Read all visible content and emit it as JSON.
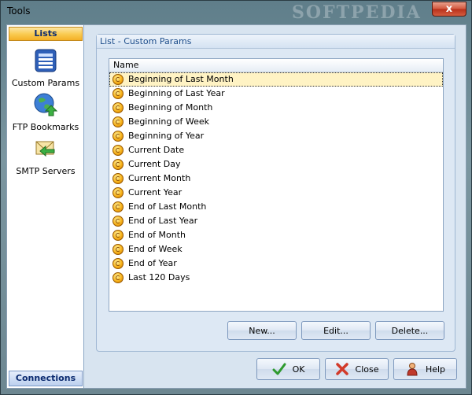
{
  "window": {
    "title": "Tools",
    "watermark": "SOFTPEDIA",
    "close_glyph": "x"
  },
  "nav": {
    "header": "Lists",
    "items": [
      {
        "label": "Custom Params",
        "icon": "custom-params-icon"
      },
      {
        "label": "FTP Bookmarks",
        "icon": "ftp-globe-icon"
      },
      {
        "label": "SMTP Servers",
        "icon": "smtp-envelope-icon"
      }
    ],
    "footer": "Connections"
  },
  "main": {
    "group_title": "List - Custom Params",
    "column_header": "Name",
    "rows": [
      "Beginning of Last Month",
      "Beginning of Last Year",
      "Beginning of Month",
      "Beginning of Week",
      "Beginning of Year",
      "Current Date",
      "Current Day",
      "Current Month",
      "Current Year",
      "End of Last Month",
      "End of Last Year",
      "End of Month",
      "End of Week",
      "End of Year",
      "Last 120 Days"
    ],
    "selected_row": 0,
    "buttons": {
      "new": "New...",
      "edit": "Edit...",
      "delete": "Delete..."
    }
  },
  "footer": {
    "ok": "OK",
    "close": "Close",
    "help": "Help"
  },
  "colors": {
    "accent": "#f9c94e",
    "title_text": "#1f4f8c",
    "selection": "#fff3c4"
  }
}
